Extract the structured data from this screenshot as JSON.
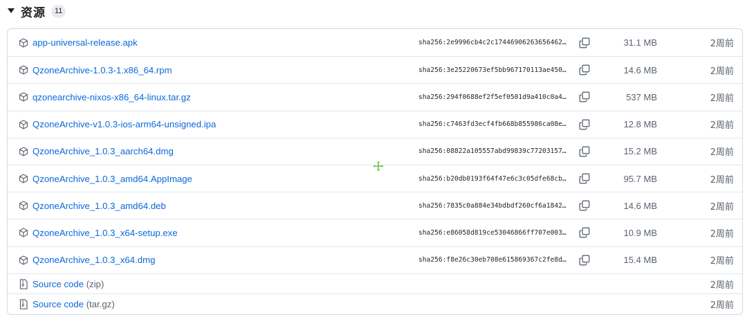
{
  "section": {
    "title": "资源",
    "count": "11"
  },
  "assets": [
    {
      "name": "app-universal-release.apk",
      "hash": "sha256:2e9996cb4c2c17446906263656462…",
      "size": "31.1 MB",
      "date": "2周前"
    },
    {
      "name": "QzoneArchive-1.0.3-1.x86_64.rpm",
      "hash": "sha256:3e25220673ef5bb967170113ae450…",
      "size": "14.6 MB",
      "date": "2周前"
    },
    {
      "name": "qzonearchive-nixos-x86_64-linux.tar.gz",
      "hash": "sha256:294f0688ef2f5ef0501d9a410c0a4…",
      "size": "537 MB",
      "date": "2周前"
    },
    {
      "name": "QzoneArchive-v1.0.3-ios-arm64-unsigned.ipa",
      "hash": "sha256:c7463fd3ecf4fb668b855986ca08e…",
      "size": "12.8 MB",
      "date": "2周前"
    },
    {
      "name": "QzoneArchive_1.0.3_aarch64.dmg",
      "hash": "sha256:08822a105557abd99839c77203157…",
      "size": "15.2 MB",
      "date": "2周前"
    },
    {
      "name": "QzoneArchive_1.0.3_amd64.AppImage",
      "hash": "sha256:b20db0193f64f47e6c3c05dfe68cb…",
      "size": "95.7 MB",
      "date": "2周前"
    },
    {
      "name": "QzoneArchive_1.0.3_amd64.deb",
      "hash": "sha256:7835c0a884e34bdbdf260cf6a1842…",
      "size": "14.6 MB",
      "date": "2周前"
    },
    {
      "name": "QzoneArchive_1.0.3_x64-setup.exe",
      "hash": "sha256:e86058d819ce53046866ff707e003…",
      "size": "10.9 MB",
      "date": "2周前"
    },
    {
      "name": "QzoneArchive_1.0.3_x64.dmg",
      "hash": "sha256:f8e26c30eb708e615869367c2fe8d…",
      "size": "15.4 MB",
      "date": "2周前"
    }
  ],
  "sources": [
    {
      "label": "Source code",
      "format": "(zip)",
      "date": "2周前"
    },
    {
      "label": "Source code",
      "format": "(tar.gz)",
      "date": "2周前"
    }
  ],
  "icons": {
    "package": "package-icon",
    "zip": "file-zip-icon",
    "copy": "copy-icon",
    "caret": "triangle-down-icon",
    "cursor": "move-cursor-icon"
  },
  "colors": {
    "link": "#0969da",
    "muted": "#59636e",
    "border": "#d1d9e0",
    "cursor": "#6cc24a"
  }
}
